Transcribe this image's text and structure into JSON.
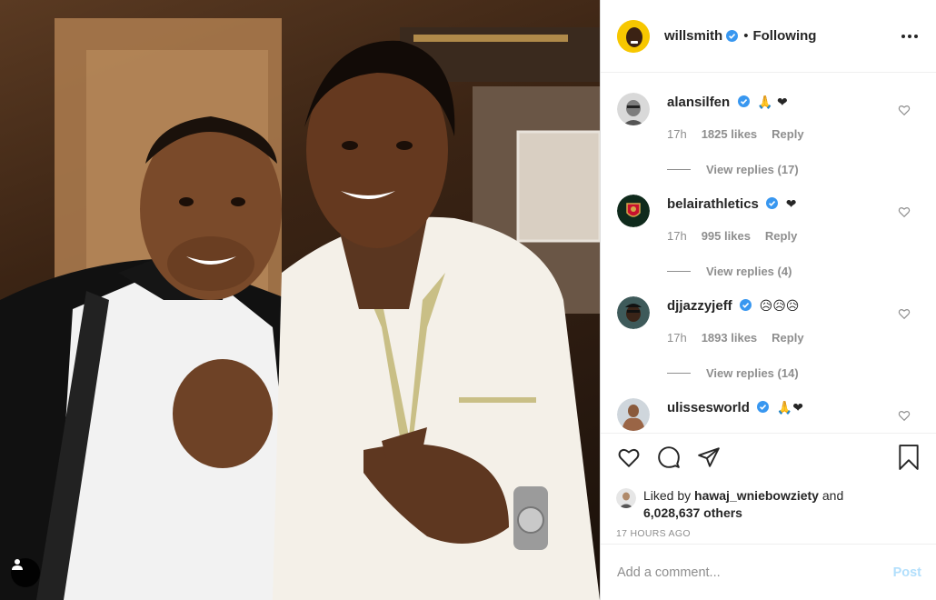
{
  "post": {
    "author": "willsmith",
    "follow_status": "Following",
    "dot": "•"
  },
  "comments": [
    {
      "username": "alansilfen",
      "text": "🙏 ❤",
      "age": "17h",
      "likes": "1825 likes",
      "reply_label": "Reply",
      "view_replies": "View replies (17)"
    },
    {
      "username": "belairathletics",
      "text": "❤",
      "age": "17h",
      "likes": "995 likes",
      "reply_label": "Reply",
      "view_replies": "View replies (4)"
    },
    {
      "username": "djjazzyjeff",
      "text": "😥😥😥",
      "age": "17h",
      "likes": "1893 likes",
      "reply_label": "Reply",
      "view_replies": "View replies (14)"
    },
    {
      "username": "ulissesworld",
      "text": "🙏❤"
    }
  ],
  "likes": {
    "prefix": "Liked by",
    "user": "hawaj_wniebowziety",
    "connector": "and",
    "others": "6,028,637 others"
  },
  "timestamp": "17 HOURS AGO",
  "add_comment": {
    "placeholder": "Add a comment...",
    "post_label": "Post"
  },
  "colors": {
    "verified_blue": "#3897f0",
    "heart_red": "#ed1c24",
    "post_disabled": "#b2dffc",
    "meta_gray": "#8e8e8e"
  },
  "icons": {
    "more": "more-options-icon",
    "like": "heart-icon",
    "comment": "comment-icon",
    "share": "share-icon",
    "save": "bookmark-icon",
    "tag": "user-tag-icon"
  }
}
